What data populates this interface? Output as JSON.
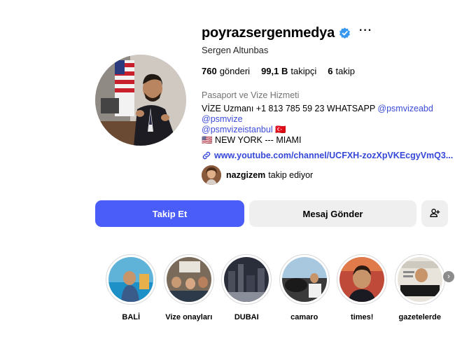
{
  "profile": {
    "username": "poyrazsergenmedya",
    "full_name": "Sergen Altunbas",
    "stats": {
      "posts_value": "760",
      "posts_label": "gönderi",
      "followers_value": "99,1 B",
      "followers_label": "takipçi",
      "following_value": "6",
      "following_label": "takip"
    },
    "category": "Pasaport ve Vize Hizmeti",
    "bio": {
      "line1_text": "VİZE Uzmanı +1 813 785 59 23 WHATSAPP ",
      "line1_tag": "@psmvizeabd",
      "line2_tag": "@psmvize",
      "line3_tag": "@psmvizeistanbul",
      "line3_flag": "🇹🇷",
      "line4_flag": "🇺🇸",
      "line4_text": " NEW YORK --- MIAMI"
    },
    "link": "www.youtube.com/channel/UCFXH-zozXpVKEcgyVmQ3...",
    "followed_by": {
      "name": "nazgizem",
      "suffix": "takip ediyor"
    }
  },
  "actions": {
    "follow_label": "Takip Et",
    "message_label": "Mesaj Gönder",
    "more_label": "···"
  },
  "highlights": [
    {
      "label": "BALİ"
    },
    {
      "label": "Vize onayları"
    },
    {
      "label": "DUBAI"
    },
    {
      "label": "camaro"
    },
    {
      "label": "times!"
    },
    {
      "label": "gazetelerde"
    }
  ],
  "colors": {
    "accent": "#4a5df9",
    "verified": "#3897f0",
    "link": "#3547d8",
    "secondary_button": "#efefef"
  },
  "icons": [
    "verified-badge-icon",
    "more-icon",
    "link-icon",
    "add-user-icon",
    "chevron-right-icon"
  ]
}
